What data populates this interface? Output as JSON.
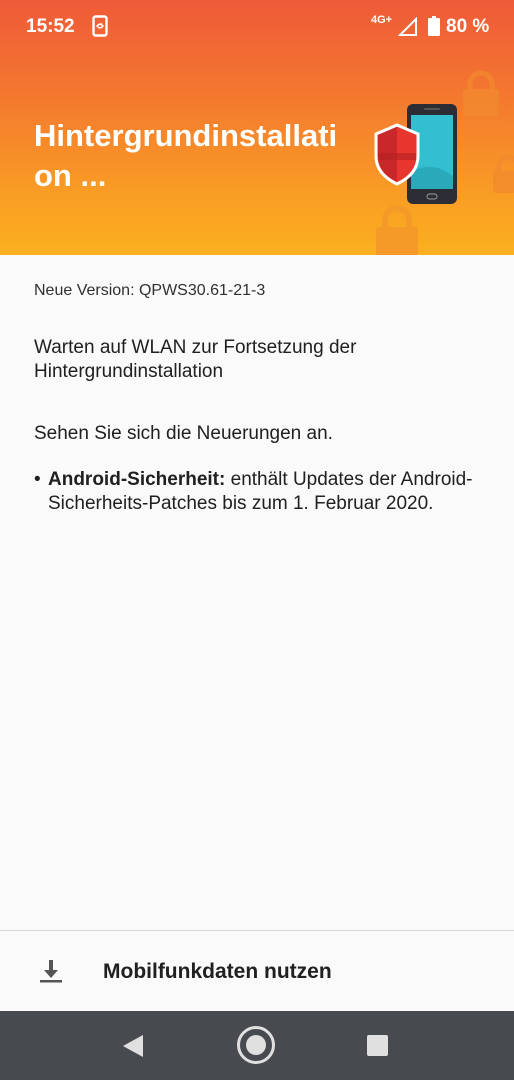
{
  "statusbar": {
    "time": "15:52",
    "network": "4G+",
    "battery": "80 %",
    "app_icon": "phone-sync-icon",
    "signal_icon": "signal-icon",
    "battery_icon": "battery-icon"
  },
  "header": {
    "title": "Hintergrundinstallation ...",
    "illustration": "phone-shield-locks-illustration",
    "colors": {
      "top": "#ef5a38",
      "bottom": "#fbb01f"
    }
  },
  "content": {
    "version": "Neue Version: QPWS30.61-21-3",
    "wait_message": "Warten auf WLAN zur Fortsetzung der Hintergrundinstallation",
    "news_intro": "Sehen Sie sich die Neuerungen an.",
    "bullets": [
      {
        "bold": "Android-Sicherheit:",
        "text": " enthält Updates der Android-Sicherheits-Patches bis zum 1. Februar 2020."
      }
    ]
  },
  "bottom_action": {
    "label": "Mobilfunkdaten nutzen",
    "icon": "download-icon"
  },
  "navbar": {
    "back_icon": "back-icon",
    "home_icon": "home-icon",
    "recent_icon": "recent-apps-icon",
    "color": "#474b50"
  }
}
